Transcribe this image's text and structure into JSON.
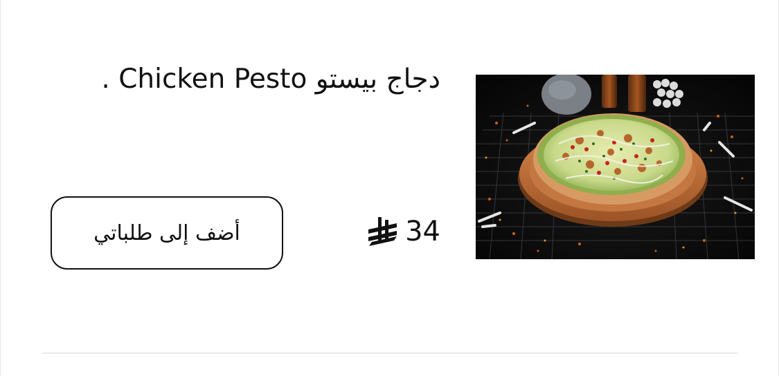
{
  "product": {
    "title": "دجاج بيستو Chicken Pesto .",
    "price": "34",
    "currency_icon": "saudi-riyal-icon",
    "image_icon": "pizza-photo"
  },
  "actions": {
    "add_to_cart_label": "أضف إلى طلباتي"
  }
}
